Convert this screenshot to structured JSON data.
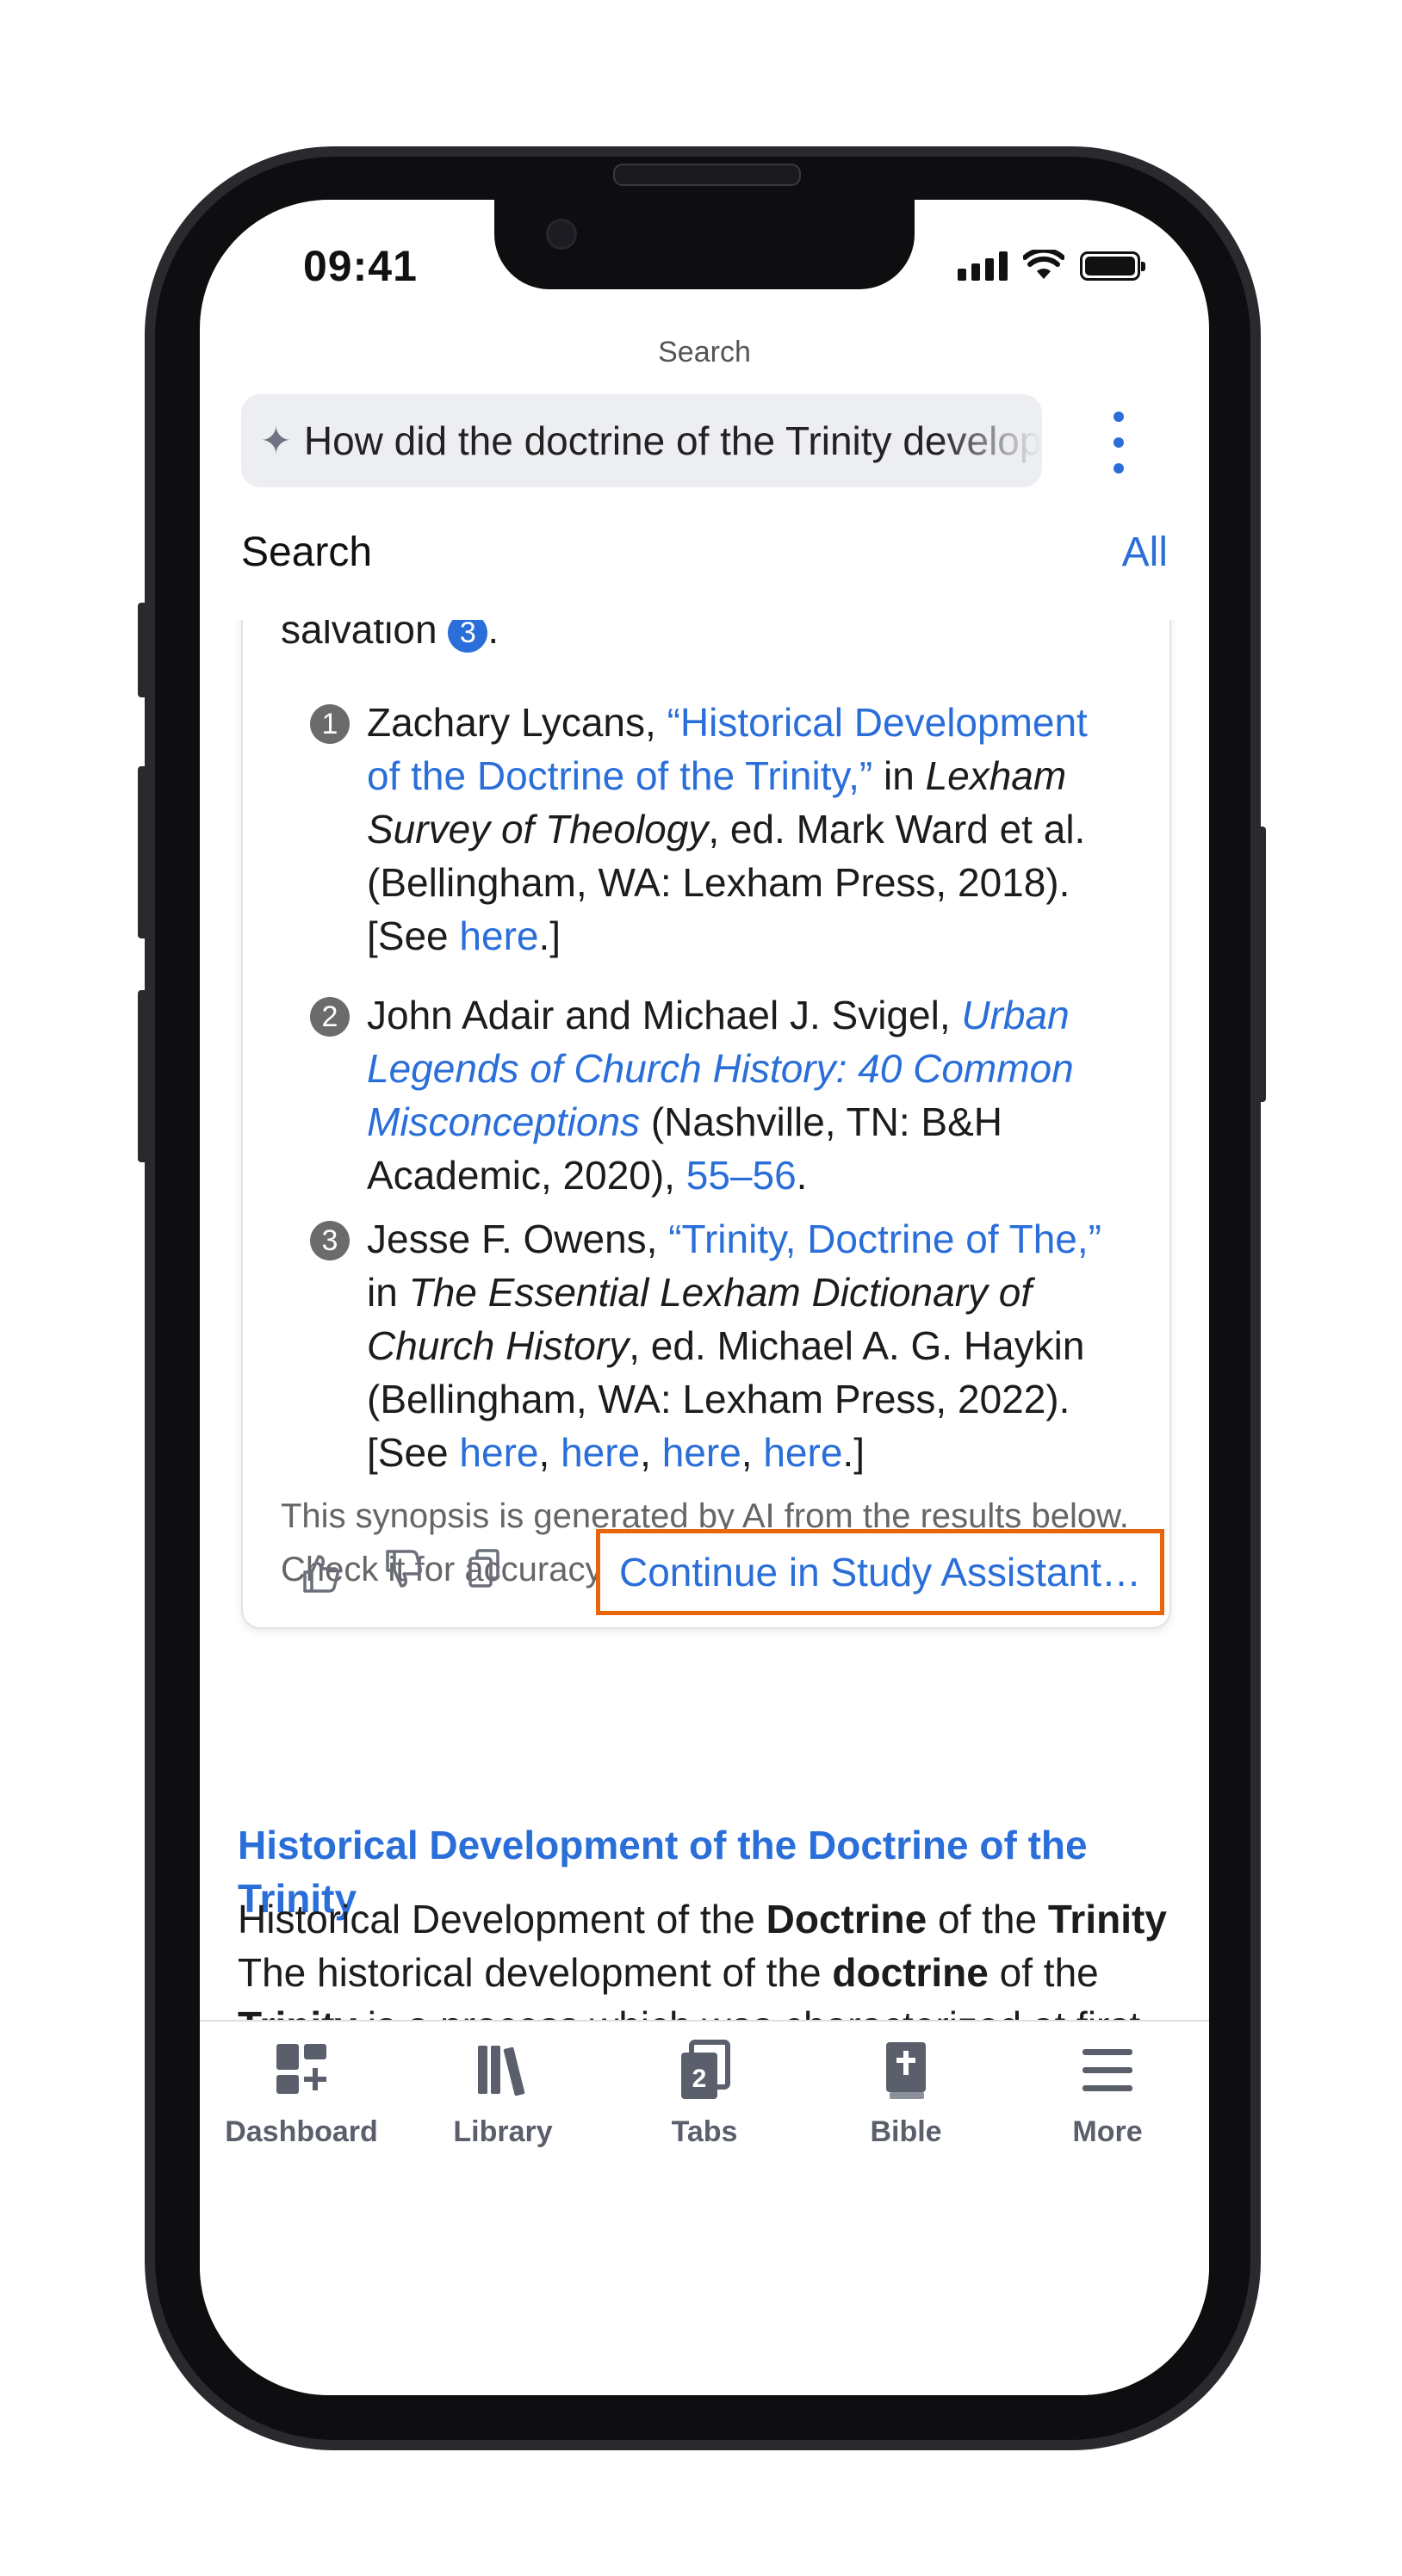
{
  "status_bar": {
    "time": "09:41"
  },
  "header": {
    "title": "Search",
    "search_query": "How did the doctrine of the Trinity develop",
    "left_tab": "Search",
    "right_tab": "All"
  },
  "synopsis": {
    "tail_text": "salvation",
    "tail_cite": "3",
    "tail_period": ".",
    "references": [
      {
        "num": "1",
        "author": "Zachary Lycans, ",
        "title": "“Historical Development of the Doctrine of the Trinity,”",
        "in": " in ",
        "work": "Lexham Survey of Theology",
        "rest": ", ed. Mark Ward et al. (Bellingham, WA: Lexham Press, 2018). [See ",
        "links": [
          "here"
        ],
        "end": ".]"
      },
      {
        "num": "2",
        "author": "John Adair and Michael J. Svigel, ",
        "title": "Urban Legends of Church History: 40 Common Misconceptions",
        "rest": " (Nashville, TN: B&H Academic, 2020), ",
        "pages": "55–56",
        "end": "."
      },
      {
        "num": "3",
        "author": "Jesse F. Owens, ",
        "title": "“Trinity, Doctrine of The,”",
        "in": " in ",
        "work": "The Essential Lexham Dictionary of Church History",
        "rest": ", ed. Michael A. G. Haykin (Bellingham, WA: Lexham Press, 2022). [See ",
        "links": [
          "here",
          "here",
          "here",
          "here"
        ],
        "end": ".]"
      }
    ],
    "ai_note_line1": "This synopsis is generated by AI from the results below.",
    "ai_note_line2": "Check it for accuracy.",
    "continue_label": "Continue in Study Assistant…"
  },
  "result": {
    "title": "Historical Development of the Doctrine of the Trinity",
    "body_parts": [
      "Historical Development of the ",
      "Doctrine",
      " of the ",
      "Trinity",
      " The historical development of the ",
      "doctrine",
      " of the ",
      "Trinity",
      " is a process which was characterized at first by foreshadowing and revelation and then later by clarification and expression. It is the story"
    ]
  },
  "bottom_nav": {
    "items": [
      {
        "label": "Dashboard",
        "icon": "dashboard-icon"
      },
      {
        "label": "Library",
        "icon": "library-icon"
      },
      {
        "label": "Tabs",
        "icon": "tabs-icon",
        "badge": "2"
      },
      {
        "label": "Bible",
        "icon": "bible-icon"
      },
      {
        "label": "More",
        "icon": "menu-icon"
      }
    ]
  },
  "colors": {
    "accent": "#2a6ed9",
    "highlight_border": "#e8650c",
    "nav_gray": "#5a5f6b"
  }
}
